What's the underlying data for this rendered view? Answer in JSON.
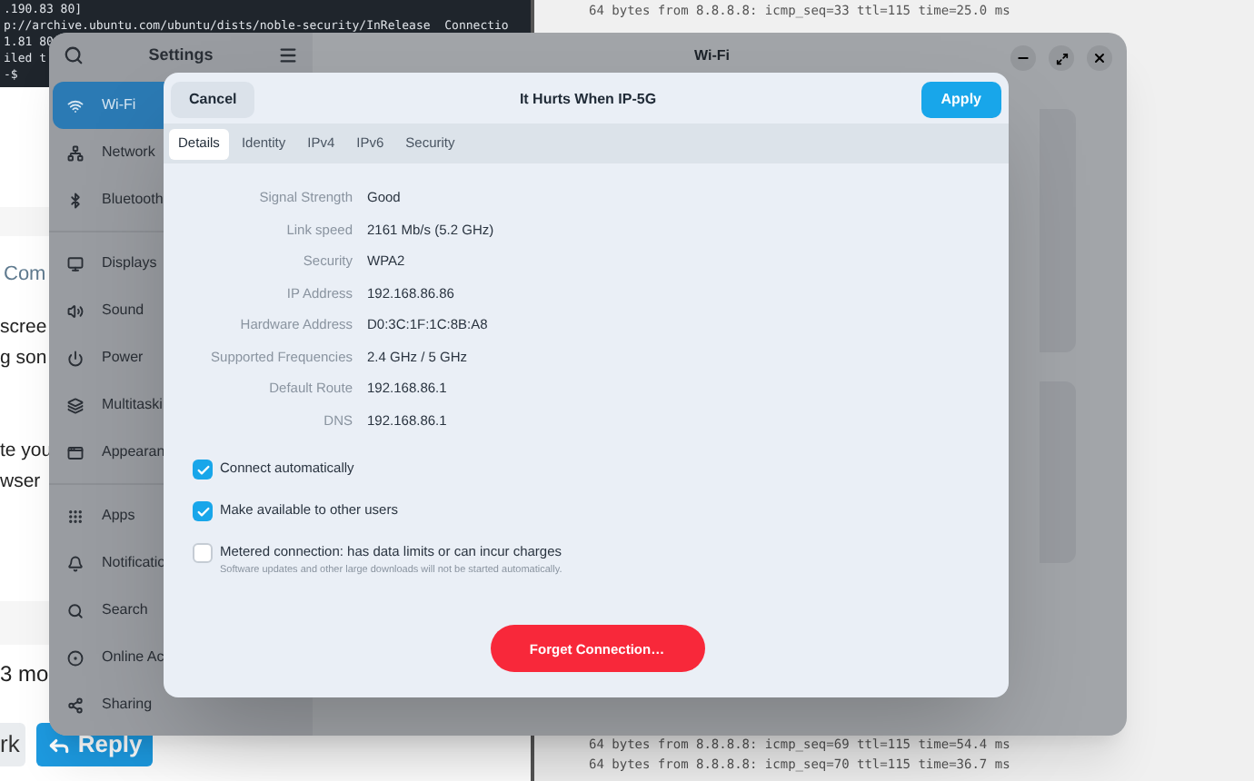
{
  "terminal_left": {
    "lines": [
      ".190.83 80]",
      "p://archive.ubuntu.com/ubuntu/dists/noble-security/InRelease  Connectio",
      "1.81 80",
      "iled t",
      "-$"
    ]
  },
  "forum": {
    "heading": "Com",
    "paragraphs": [
      [
        "scree",
        "g son"
      ],
      [
        "te you",
        "wser"
      ]
    ],
    "meta": "3 mo",
    "buttons": [
      {
        "label": "rk",
        "kind": "secondary"
      },
      {
        "label": "Reply",
        "kind": "primary"
      }
    ]
  },
  "terminal_right": {
    "lines_top": [
      "64 bytes from 8.8.8.8: icmp_seq=33 ttl=115 time=25.0 ms"
    ],
    "lines_bottom": [
      "64 bytes from 8.8.8.8: icmp_seq=69 ttl=115 time=54.4 ms",
      "64 bytes from 8.8.8.8: icmp_seq=70 ttl=115 time=36.7 ms"
    ]
  },
  "settings": {
    "title": "Settings",
    "page_title": "Wi-Fi",
    "groups": [
      {
        "items": [
          {
            "label": "Wi-Fi",
            "selected": true
          },
          {
            "label": "Network",
            "selected": false
          },
          {
            "label": "Bluetooth",
            "selected": false
          }
        ]
      },
      {
        "items": [
          {
            "label": "Displays",
            "selected": false
          },
          {
            "label": "Sound",
            "selected": false
          },
          {
            "label": "Power",
            "selected": false
          },
          {
            "label": "Multitaski",
            "selected": false
          },
          {
            "label": "Appearan",
            "selected": false
          }
        ]
      },
      {
        "items": [
          {
            "label": "Apps",
            "selected": false
          },
          {
            "label": "Notificatio",
            "selected": false
          },
          {
            "label": "Search",
            "selected": false
          },
          {
            "label": "Online Ac",
            "selected": false
          },
          {
            "label": "Sharing",
            "selected": false
          }
        ]
      }
    ]
  },
  "dialog": {
    "title": "It Hurts When IP-5G",
    "cancel": "Cancel",
    "apply": "Apply",
    "tabs": [
      {
        "label": "Details",
        "selected": true
      },
      {
        "label": "Identity",
        "selected": false
      },
      {
        "label": "IPv4",
        "selected": false
      },
      {
        "label": "IPv6",
        "selected": false
      },
      {
        "label": "Security",
        "selected": false
      }
    ],
    "details": [
      {
        "label": "Signal Strength",
        "value": "Good"
      },
      {
        "label": "Link speed",
        "value": "2161 Mb/s (5.2 GHz)"
      },
      {
        "label": "Security",
        "value": "WPA2"
      },
      {
        "label": "IP Address",
        "value": "192.168.86.86"
      },
      {
        "label": "Hardware Address",
        "value": "D0:3C:1F:1C:8B:A8"
      },
      {
        "label": "Supported Frequencies",
        "value": "2.4 GHz / 5 GHz"
      },
      {
        "label": "Default Route",
        "value": "192.168.86.1"
      },
      {
        "label": "DNS",
        "value": "192.168.86.1"
      }
    ],
    "options": [
      {
        "label": "Connect automatically",
        "checked": true
      },
      {
        "label": "Make available to other users",
        "checked": true
      },
      {
        "label": "Metered connection: has data limits or can incur charges",
        "hint": "Software updates and other large downloads will not be started automatically.",
        "checked": false
      }
    ],
    "forget": "Forget Connection…"
  }
}
